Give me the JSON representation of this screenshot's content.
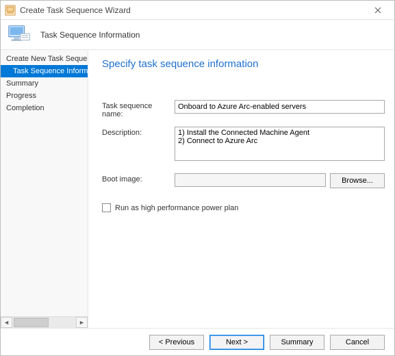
{
  "window": {
    "title": "Create Task Sequence Wizard"
  },
  "banner": {
    "title": "Task Sequence Information"
  },
  "sidebar": {
    "steps": [
      {
        "label": "Create New Task Sequence",
        "sub": false,
        "selected": false
      },
      {
        "label": "Task Sequence Information",
        "sub": true,
        "selected": true
      },
      {
        "label": "Summary",
        "sub": false,
        "selected": false
      },
      {
        "label": "Progress",
        "sub": false,
        "selected": false
      },
      {
        "label": "Completion",
        "sub": false,
        "selected": false
      }
    ]
  },
  "main": {
    "heading": "Specify task sequence information",
    "fields": {
      "name_label": "Task sequence name:",
      "name_value": "Onboard to Azure Arc-enabled servers",
      "desc_label": "Description:",
      "desc_value": "1) Install the Connected Machine Agent\n2) Connect to Azure Arc",
      "boot_label": "Boot image:",
      "boot_value": "",
      "browse_label": "Browse...",
      "chk_label": "Run as high performance power plan",
      "chk_checked": false
    }
  },
  "footer": {
    "previous": "< Previous",
    "next": "Next >",
    "summary": "Summary",
    "cancel": "Cancel"
  }
}
